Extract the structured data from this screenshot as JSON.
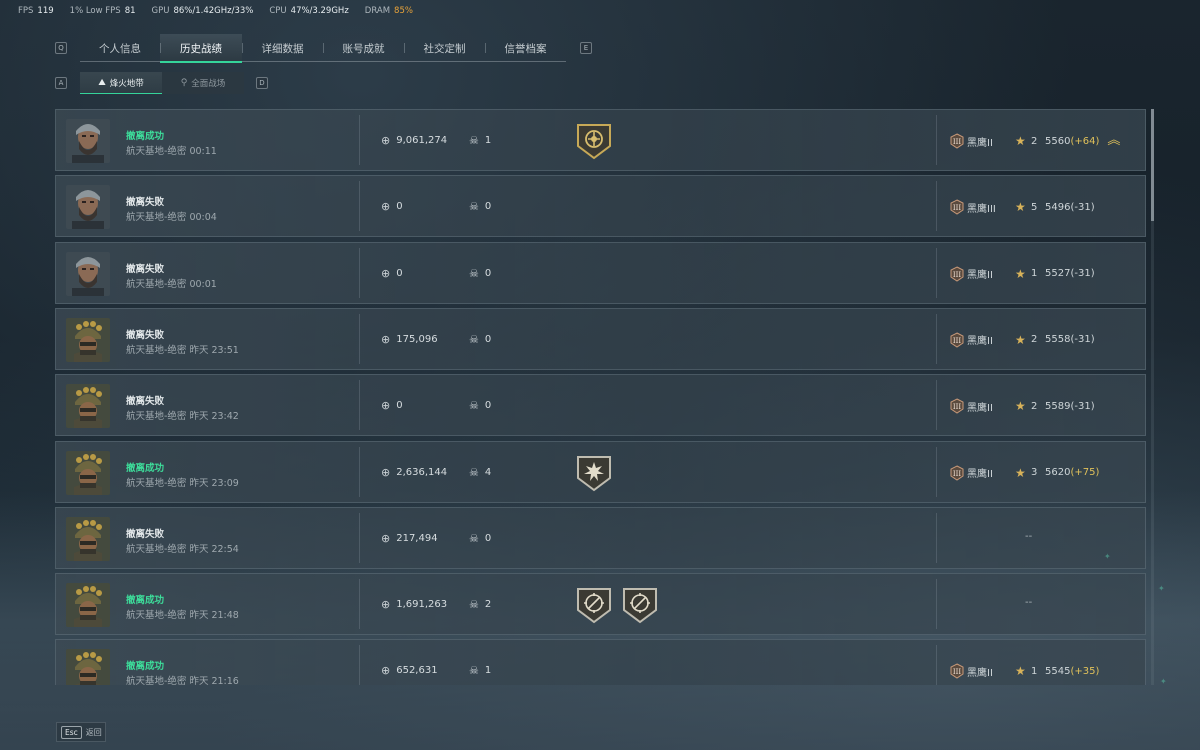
{
  "perf": {
    "fps_label": "FPS",
    "fps": "119",
    "low_label": "1% Low FPS",
    "low": "81",
    "gpu_label": "GPU",
    "gpu": "86%/1.42GHz/33%",
    "cpu_label": "CPU",
    "cpu": "47%/3.29GHz",
    "dram_label": "DRAM",
    "dram": "85%"
  },
  "keyhints": {
    "prev_tab": "Q",
    "next_tab": "E",
    "prev_sub": "A",
    "next_sub": "D"
  },
  "tabs": [
    {
      "label": "个人信息"
    },
    {
      "label": "历史战绩"
    },
    {
      "label": "详细数据"
    },
    {
      "label": "账号成就"
    },
    {
      "label": "社交定制"
    },
    {
      "label": "信誉档案"
    }
  ],
  "active_tab": 1,
  "subtabs": [
    {
      "label": "烽火地带",
      "icon": "mountain-icon"
    },
    {
      "label": "全面战场",
      "icon": "paratrooper-icon"
    }
  ],
  "active_subtab": 0,
  "matches": [
    {
      "result": "撤离成功",
      "success": true,
      "map": "航天基地-绝密 00:11",
      "value": "9,061,274",
      "kills": "1",
      "medals": [
        "shield-crown"
      ],
      "rank": "黑鹰II",
      "rank_level": "2",
      "score": "5560",
      "delta": "(+64)",
      "delta_up": true,
      "promo": true,
      "avatar": "bearded",
      "empty_rank": ""
    },
    {
      "result": "撤离失败",
      "success": false,
      "map": "航天基地-绝密 00:04",
      "value": "0",
      "kills": "0",
      "medals": [],
      "rank": "黑鹰III",
      "rank_level": "5",
      "score": "5496",
      "delta": "(-31)",
      "delta_up": false,
      "promo": false,
      "avatar": "bearded",
      "empty_rank": ""
    },
    {
      "result": "撤离失败",
      "success": false,
      "map": "航天基地-绝密 00:01",
      "value": "0",
      "kills": "0",
      "medals": [],
      "rank": "黑鹰II",
      "rank_level": "1",
      "score": "5527",
      "delta": "(-31)",
      "delta_up": false,
      "promo": false,
      "avatar": "bearded",
      "empty_rank": ""
    },
    {
      "result": "撤离失败",
      "success": false,
      "map": "航天基地-绝密 昨天 23:51",
      "value": "175,096",
      "kills": "0",
      "medals": [],
      "rank": "黑鹰II",
      "rank_level": "2",
      "score": "5558",
      "delta": "(-31)",
      "delta_up": false,
      "promo": false,
      "avatar": "helmet",
      "empty_rank": ""
    },
    {
      "result": "撤离失败",
      "success": false,
      "map": "航天基地-绝密 昨天 23:42",
      "value": "0",
      "kills": "0",
      "medals": [],
      "rank": "黑鹰II",
      "rank_level": "2",
      "score": "5589",
      "delta": "(-31)",
      "delta_up": false,
      "promo": false,
      "avatar": "helmet",
      "empty_rank": ""
    },
    {
      "result": "撤离成功",
      "success": true,
      "map": "航天基地-绝密 昨天 23:09",
      "value": "2,636,144",
      "kills": "4",
      "medals": [
        "shield-burst"
      ],
      "rank": "黑鹰II",
      "rank_level": "3",
      "score": "5620",
      "delta": "(+75)",
      "delta_up": true,
      "promo": false,
      "avatar": "helmet",
      "empty_rank": ""
    },
    {
      "result": "撤离失败",
      "success": false,
      "map": "航天基地-绝密 昨天 22:54",
      "value": "217,494",
      "kills": "0",
      "medals": [],
      "rank": "",
      "rank_level": "",
      "score": "",
      "delta": "",
      "delta_up": false,
      "promo": false,
      "avatar": "helmet",
      "empty_rank": "--"
    },
    {
      "result": "撤离成功",
      "success": true,
      "map": "航天基地-绝密 昨天 21:48",
      "value": "1,691,263",
      "kills": "2",
      "medals": [
        "shield-crosshair",
        "shield-crosshair"
      ],
      "rank": "",
      "rank_level": "",
      "score": "",
      "delta": "",
      "delta_up": false,
      "promo": false,
      "avatar": "helmet",
      "empty_rank": "--"
    },
    {
      "result": "撤离成功",
      "success": true,
      "map": "航天基地-绝密 昨天 21:16",
      "value": "652,631",
      "kills": "1",
      "medals": [],
      "rank": "黑鹰II",
      "rank_level": "1",
      "score": "5545",
      "delta": "(+35)",
      "delta_up": true,
      "promo": false,
      "avatar": "helmet",
      "empty_rank": ""
    }
  ],
  "footer": {
    "esc_key": "Esc",
    "back_label": "返回"
  },
  "colors": {
    "accent": "#35d49a",
    "success": "#3ddc9a",
    "gain": "#e0c15a",
    "warn": "#e8a33a"
  }
}
